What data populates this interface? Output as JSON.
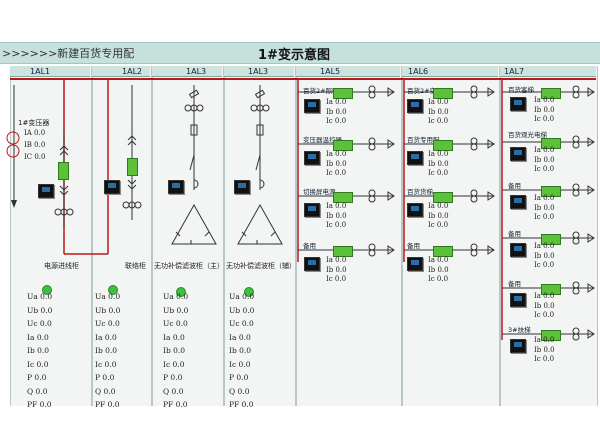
{
  "header": {
    "subsystem": ">>>>>>新建百货专用配",
    "title": "1#变示意图"
  },
  "columns": [
    {
      "id": "1AL1",
      "caption": "电源进线柜"
    },
    {
      "id": "1AL2",
      "caption": "联络柜"
    },
    {
      "id": "1AL3",
      "caption": "无功补偿滤波柜（主）"
    },
    {
      "id": "1AL3",
      "caption": "无功补偿滤波柜（辅）"
    },
    {
      "id": "1AL5",
      "caption": ""
    },
    {
      "id": "1AL6",
      "caption": ""
    },
    {
      "id": "1AL7",
      "caption": ""
    }
  ],
  "transformer": {
    "label": "1#变压器",
    "readings": [
      "IA 0.0",
      "IB 0.0",
      "IC 0.0"
    ]
  },
  "panel_measurements": [
    [
      "Ua 0.0",
      "Ub 0.0",
      "Uc 0.0",
      "Ia 0.0",
      "Ib 0.0",
      "Ic 0.0",
      "P  0.0",
      "Q  0.0",
      "PF 0.0"
    ],
    [
      "Ua 0.0",
      "Ub 0.0",
      "Uc 0.0",
      "Ia 0.0",
      "Ib 0.0",
      "Ic 0.0",
      "P  0.0",
      "Q  0.0",
      "PF 0.0"
    ],
    [
      "Ua 0.0",
      "Ub 0.0",
      "Uc 0.0",
      "Ia 0.0",
      "Ib 0.0",
      "Ic 0.0",
      "P  0.0",
      "Q  0.0",
      "PF 0.0"
    ],
    [
      "Ua 0.0",
      "Ub 0.0",
      "Uc 0.0",
      "Ia 0.0",
      "Ib 0.0",
      "Ic 0.0",
      "P  0.0",
      "Q  0.0",
      "PF 0.0"
    ]
  ],
  "feeders_1AL5": [
    {
      "name": "百货2#照明",
      "readings": [
        "Ia 0.0",
        "Ib 0.0",
        "Ic 0.0"
      ]
    },
    {
      "name": "变压器温控器",
      "readings": [
        "Ia 0.0",
        "Ib 0.0",
        "Ic 0.0"
      ]
    },
    {
      "name": "切换屏电源",
      "readings": [
        "Ia 0.0",
        "Ib 0.0",
        "Ic 0.0"
      ]
    },
    {
      "name": "备用",
      "readings": [
        "Ia 0.0",
        "Ib 0.0",
        "Ic 0.0"
      ]
    }
  ],
  "feeders_1AL6": [
    {
      "name": "百货2#空调",
      "readings": [
        "Ia 0.0",
        "Ib 0.0",
        "Ic 0.0"
      ]
    },
    {
      "name": "百货专用配",
      "readings": [
        "Ia 0.0",
        "Ib 0.0",
        "Ic 0.0"
      ]
    },
    {
      "name": "百货货梯",
      "readings": [
        "Ia 0.0",
        "Ib 0.0",
        "Ic 0.0"
      ]
    },
    {
      "name": "备用",
      "readings": [
        "Ia 0.0",
        "Ib 0.0",
        "Ic 0.0"
      ]
    }
  ],
  "feeders_1AL7": [
    {
      "name": "百货客梯",
      "readings": [
        "Ia 0.0",
        "Ib 0.0",
        "Ic 0.0"
      ]
    },
    {
      "name": "百货观光电梯",
      "readings": [
        "Ia 0.0",
        "Ib 0.0",
        "Ic 0.0"
      ]
    },
    {
      "name": "备用",
      "readings": [
        "Ia 0.0",
        "Ib 0.0",
        "Ic 0.0"
      ]
    },
    {
      "name": "备用",
      "readings": [
        "Ia 0.0",
        "Ib 0.0",
        "Ic 0.0"
      ]
    },
    {
      "name": "备用",
      "readings": [
        "Ia 0.0",
        "Ib 0.0",
        "Ic 0.0"
      ]
    },
    {
      "name": "3#扶梯",
      "readings": [
        "Ia 0.0",
        "Ib 0.0",
        "Ic 0.0"
      ]
    }
  ],
  "colors": {
    "busbar": "#c0161a",
    "breaker": "#5cc03a",
    "status_on": "#3fbf3f"
  }
}
